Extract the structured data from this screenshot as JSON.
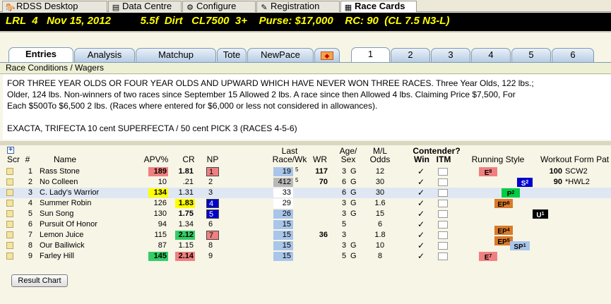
{
  "top_tabs": [
    {
      "label": "RDSS Desktop",
      "icon": "horse-icon"
    },
    {
      "label": "Data Centre",
      "icon": "data-icon"
    },
    {
      "label": "Configure",
      "icon": "gear-icon"
    },
    {
      "label": "Registration",
      "icon": "registration-icon"
    },
    {
      "label": "Race Cards",
      "icon": "cards-icon",
      "active": true
    }
  ],
  "race_header": "LRL  4   Nov 15, 2012          5.5f  Dirt   CL7500  3+    Purse: $17,000    RC: 90  (CL 7.5 N3-L)",
  "sub_tabs": [
    "Entries",
    "Analysis",
    "Matchup",
    "Tote",
    "NewPace"
  ],
  "race_tabs": [
    "1",
    "2",
    "3",
    "4",
    "5",
    "6"
  ],
  "conditions": {
    "header": "Race Conditions / Wagers",
    "lines": [
      "FOR THREE YEAR OLDS OR FOUR YEAR OLDS AND UPWARD WHICH HAVE NEVER WON THREE RACES. Three Year Olds, 122 lbs.;",
      "Older, 124 lbs. Non-winners of two races since September 15 Allowed 2 lbs. A race since then Allowed 4 lbs. Claiming Price $7,500, For",
      "Each $500To $6,500 2 lbs. (Races where entered for $6,000 or less not considered in allowances).",
      "",
      "EXACTA, TRIFECTA 10 cent SUPERFECTA / 50 cent PICK 3 (RACES 4-5-6)"
    ]
  },
  "columns": {
    "scr": "Scr",
    "num": "#",
    "name": "Name",
    "apv": "APV%",
    "cr": "CR",
    "np": "NP",
    "last1": "Last",
    "last2": "Race/Wk",
    "wr": "WR",
    "age1": "Age/",
    "age2": "Sex",
    "ml1": "M/L",
    "ml2": "Odds",
    "contender": "Contender?",
    "win": "Win",
    "itm": "ITM",
    "running": "Running Style",
    "workout": "Workout Form Pat"
  },
  "horses": [
    {
      "num": "1",
      "name": "Rass Stone",
      "apv": "189",
      "cr": "1.81",
      "np": "1",
      "last": "19",
      "wk": "5",
      "wr": "117",
      "age": "3",
      "sex": "G",
      "ml": "12",
      "rs": "E",
      "rs_n": "8",
      "work_n": "100",
      "work_p": "SCW2"
    },
    {
      "num": "2",
      "name": "No Colleen",
      "apv": "10",
      "cr": ".21",
      "np": "2",
      "last": "412",
      "wk": "5",
      "wr": "70",
      "age": "6",
      "sex": "G",
      "ml": "30",
      "rs": "S",
      "rs_n": "2",
      "work_n": "90",
      "work_p": "*HWL2"
    },
    {
      "num": "3",
      "name": "C. Lady's Warrior",
      "apv": "134",
      "cr": "1.31",
      "np": "3",
      "last": "33",
      "wk": "",
      "wr": "",
      "age": "6",
      "sex": "G",
      "ml": "30",
      "rs": "P",
      "rs_n": "2",
      "work_n": "",
      "work_p": ""
    },
    {
      "num": "4",
      "name": "Summer Robin",
      "apv": "126",
      "cr": "1.83",
      "np": "4",
      "last": "29",
      "wk": "",
      "wr": "",
      "age": "3",
      "sex": "G",
      "ml": "1.6",
      "rs": "EP",
      "rs_n": "6",
      "work_n": "",
      "work_p": ""
    },
    {
      "num": "5",
      "name": "Sun Song",
      "apv": "130",
      "cr": "1.75",
      "np": "5",
      "last": "26",
      "wk": "",
      "wr": "",
      "age": "3",
      "sex": "G",
      "ml": "15",
      "rs": "U",
      "rs_n": "1",
      "work_n": "",
      "work_p": ""
    },
    {
      "num": "6",
      "name": "Pursuit Of Honor",
      "apv": "94",
      "cr": "1.34",
      "np": "6",
      "last": "15",
      "wk": "",
      "wr": "",
      "age": "5",
      "sex": "",
      "ml": "6",
      "rs": "",
      "rs_n": "",
      "work_n": "",
      "work_p": ""
    },
    {
      "num": "7",
      "name": "Lemon Juice",
      "apv": "115",
      "cr": "2.12",
      "np": "7",
      "last": "15",
      "wk": "",
      "wr": "36",
      "age": "3",
      "sex": "",
      "ml": "1.8",
      "rs": "EP",
      "rs_n": "4",
      "rs2": "EP",
      "rs2_n": "5",
      "work_n": "",
      "work_p": ""
    },
    {
      "num": "8",
      "name": "Our Bailiwick",
      "apv": "87",
      "cr": "1.15",
      "np": "8",
      "last": "15",
      "wk": "",
      "wr": "",
      "age": "3",
      "sex": "G",
      "ml": "10",
      "rs": "SP",
      "rs_n": "1",
      "work_n": "",
      "work_p": ""
    },
    {
      "num": "9",
      "name": "Farley Hill",
      "apv": "145",
      "cr": "2.14",
      "np": "9",
      "last": "15",
      "wk": "",
      "wr": "",
      "age": "5",
      "sex": "G",
      "ml": "8",
      "rs": "E",
      "rs_n": "7",
      "work_n": "",
      "work_p": ""
    }
  ],
  "result_button": "Result Chart",
  "win_check": "✓",
  "colors": {
    "header_bg": "#000000",
    "header_text": "#ffff00",
    "apv_red": "#f08080",
    "apv_yellow": "#ffff00",
    "apv_green": "#33cc66",
    "np_red": "#f08080",
    "np_blue": "#0000cc",
    "last_blue": "#a9c5ea",
    "last_gray": "#b8b8b8"
  }
}
